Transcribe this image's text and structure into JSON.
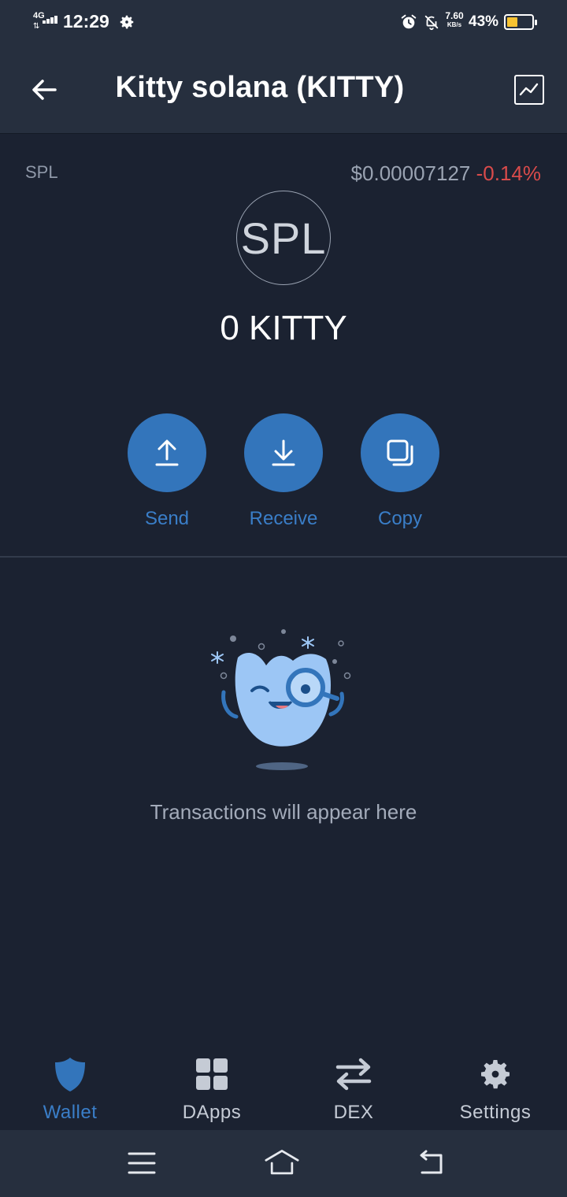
{
  "status_bar": {
    "network": "4G",
    "time": "12:29",
    "speed_value": "7.60",
    "speed_unit": "KB/s",
    "battery_percent": "43%",
    "battery_level": 0.43,
    "icons": [
      "signal-icon",
      "settings-gear-icon",
      "alarm-icon",
      "bell-off-icon",
      "battery-icon"
    ]
  },
  "header": {
    "title": "Kitty solana (KITTY)",
    "back_icon": "arrow-left-icon",
    "chart_icon": "chart-icon"
  },
  "token": {
    "type": "SPL",
    "price": "$0.00007127",
    "change": "-0.14%",
    "logo_text": "SPL",
    "balance": "0 KITTY"
  },
  "actions": [
    {
      "label": "Send",
      "icon": "send-arrow-up-icon"
    },
    {
      "label": "Receive",
      "icon": "receive-arrow-down-icon"
    },
    {
      "label": "Copy",
      "icon": "copy-icon"
    }
  ],
  "empty_state": {
    "message": "Transactions will appear here",
    "illustration": "mascot-magnifier-illustration"
  },
  "bottom_nav": [
    {
      "label": "Wallet",
      "icon": "shield-icon",
      "active": true
    },
    {
      "label": "DApps",
      "icon": "grid-icon",
      "active": false
    },
    {
      "label": "DEX",
      "icon": "swap-arrows-icon",
      "active": false
    },
    {
      "label": "Settings",
      "icon": "gear-icon",
      "active": false
    }
  ],
  "system_nav": [
    "menu-icon",
    "home-icon",
    "back-icon"
  ],
  "colors": {
    "background": "#1b2231",
    "header": "#262f3e",
    "accent": "#3375bb",
    "negative": "#d94b4b"
  }
}
